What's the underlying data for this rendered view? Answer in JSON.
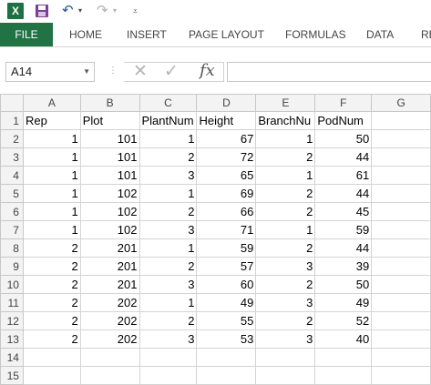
{
  "qat": {
    "app_icon_letter": "X",
    "icons": [
      "excel-icon",
      "save-icon",
      "undo-icon",
      "redo-icon",
      "customize-icon"
    ]
  },
  "ribbon": {
    "tabs": [
      "FILE",
      "HOME",
      "INSERT",
      "PAGE LAYOUT",
      "FORMULAS",
      "DATA",
      "RE"
    ],
    "file_tab_color": "#217346"
  },
  "formula_bar": {
    "name_box": "A14",
    "fx_label": "fx",
    "formula": ""
  },
  "sheet": {
    "columns": [
      "A",
      "B",
      "C",
      "D",
      "E",
      "F",
      "G"
    ],
    "row_numbers": [
      "1",
      "2",
      "3",
      "4",
      "5",
      "6",
      "7",
      "8",
      "9",
      "10",
      "11",
      "12",
      "13",
      "14",
      "15"
    ],
    "header_row": [
      "Rep",
      "Plot",
      "PlantNum",
      "Height",
      "BranchNu",
      "PodNum",
      ""
    ],
    "rows": [
      [
        "1",
        "101",
        "1",
        "67",
        "1",
        "50",
        ""
      ],
      [
        "1",
        "101",
        "2",
        "72",
        "2",
        "44",
        ""
      ],
      [
        "1",
        "101",
        "3",
        "65",
        "1",
        "61",
        ""
      ],
      [
        "1",
        "102",
        "1",
        "69",
        "2",
        "44",
        ""
      ],
      [
        "1",
        "102",
        "2",
        "66",
        "2",
        "45",
        ""
      ],
      [
        "1",
        "102",
        "3",
        "71",
        "1",
        "59",
        ""
      ],
      [
        "2",
        "201",
        "1",
        "59",
        "2",
        "44",
        ""
      ],
      [
        "2",
        "201",
        "2",
        "57",
        "3",
        "39",
        ""
      ],
      [
        "2",
        "201",
        "3",
        "60",
        "2",
        "50",
        ""
      ],
      [
        "2",
        "202",
        "1",
        "49",
        "3",
        "49",
        ""
      ],
      [
        "2",
        "202",
        "2",
        "55",
        "2",
        "52",
        ""
      ],
      [
        "2",
        "202",
        "3",
        "53",
        "3",
        "40",
        ""
      ],
      [
        "",
        "",
        "",
        "",
        "",
        "",
        ""
      ],
      [
        "",
        "",
        "",
        "",
        "",
        "",
        ""
      ]
    ]
  }
}
